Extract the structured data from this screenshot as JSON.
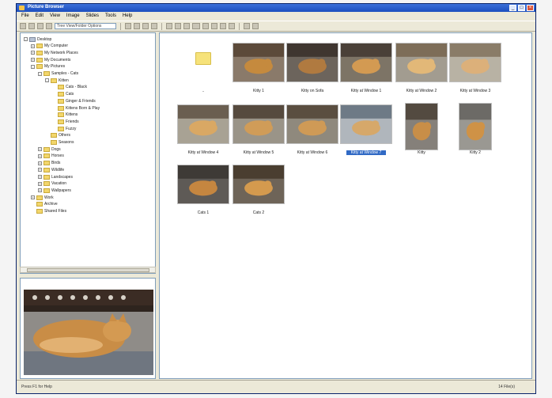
{
  "window": {
    "title": "Picture Browser"
  },
  "menu": [
    "File",
    "Edit",
    "View",
    "Image",
    "Slides",
    "Tools",
    "Help"
  ],
  "toolbar": {
    "address": "Tree View/Folder Options"
  },
  "tree": [
    {
      "label": "Desktop",
      "type": "drive",
      "level": 0,
      "exp": "-"
    },
    {
      "label": "My Computer",
      "type": "folder",
      "level": 1,
      "exp": "+"
    },
    {
      "label": "My Network Places",
      "type": "folder",
      "level": 1,
      "exp": "+"
    },
    {
      "label": "My Documents",
      "type": "folder",
      "level": 1,
      "exp": "+"
    },
    {
      "label": "My Pictures",
      "type": "folder",
      "level": 1,
      "exp": "-"
    },
    {
      "label": "Samples - Cats",
      "type": "folder",
      "level": 2,
      "exp": "-"
    },
    {
      "label": "Kitten",
      "type": "folder",
      "level": 3,
      "exp": "-"
    },
    {
      "label": "Cats - Black",
      "type": "folder",
      "level": 4,
      "exp": ""
    },
    {
      "label": "Cats",
      "type": "folder",
      "level": 4,
      "exp": ""
    },
    {
      "label": "Ginger & Friends",
      "type": "folder",
      "level": 4,
      "exp": ""
    },
    {
      "label": "Kittens Born & Play",
      "type": "folder",
      "level": 4,
      "exp": ""
    },
    {
      "label": "Kittens",
      "type": "folder",
      "level": 4,
      "exp": ""
    },
    {
      "label": "Friends",
      "type": "folder",
      "level": 4,
      "exp": ""
    },
    {
      "label": "Fuzzy",
      "type": "folder",
      "level": 4,
      "exp": ""
    },
    {
      "label": "Others",
      "type": "folder",
      "level": 3,
      "exp": ""
    },
    {
      "label": "Seasons",
      "type": "folder",
      "level": 3,
      "exp": ""
    },
    {
      "label": "Dogs",
      "type": "folder",
      "level": 2,
      "exp": "+"
    },
    {
      "label": "Horses",
      "type": "folder",
      "level": 2,
      "exp": "+"
    },
    {
      "label": "Birds",
      "type": "folder",
      "level": 2,
      "exp": "+"
    },
    {
      "label": "Wildlife",
      "type": "folder",
      "level": 2,
      "exp": "+"
    },
    {
      "label": "Landscapes",
      "type": "folder",
      "level": 2,
      "exp": "+"
    },
    {
      "label": "Vacation",
      "type": "folder",
      "level": 2,
      "exp": "+"
    },
    {
      "label": "Wallpapers",
      "type": "folder",
      "level": 2,
      "exp": "+"
    },
    {
      "label": "Work",
      "type": "folder",
      "level": 1,
      "exp": "+"
    },
    {
      "label": "Archive",
      "type": "folder",
      "level": 1,
      "exp": ""
    },
    {
      "label": "Shared Files",
      "type": "folder",
      "level": 1,
      "exp": ""
    }
  ],
  "thumbs": [
    {
      "label": "..",
      "kind": "folder",
      "selected": false
    },
    {
      "label": "Kitty 1",
      "kind": "photo",
      "selected": false,
      "palette": [
        "#5c4a3a",
        "#c58a3e",
        "#8a7a6a"
      ]
    },
    {
      "label": "Kitty on Sofa",
      "kind": "photo",
      "selected": false,
      "palette": [
        "#3f3630",
        "#b07a40",
        "#6c645c"
      ]
    },
    {
      "label": "Kitty at Window 1",
      "kind": "photo",
      "selected": false,
      "palette": [
        "#4a4038",
        "#d39a52",
        "#7d7466"
      ]
    },
    {
      "label": "Kitty at Window 2",
      "kind": "photo",
      "selected": false,
      "palette": [
        "#7d6d58",
        "#e2b878",
        "#a29c90"
      ]
    },
    {
      "label": "Kitty at Window 3",
      "kind": "photo",
      "selected": false,
      "palette": [
        "#8a7c68",
        "#dcb07a",
        "#b8b2a4"
      ]
    },
    {
      "label": "Kitty at Window 4",
      "kind": "photo",
      "selected": false,
      "palette": [
        "#6a5e50",
        "#d9a864",
        "#a8a294"
      ]
    },
    {
      "label": "Kitty at Window 5",
      "kind": "photo",
      "selected": false,
      "palette": [
        "#564a3e",
        "#d09c58",
        "#9a9488"
      ]
    },
    {
      "label": "Kitty at Window 6",
      "kind": "photo",
      "selected": false,
      "palette": [
        "#5a4e40",
        "#cf9a56",
        "#8f897d"
      ]
    },
    {
      "label": "Kitty at Window 7",
      "kind": "photo",
      "selected": true,
      "palette": [
        "#6e7a86",
        "#d6a86a",
        "#b0b6bc"
      ]
    },
    {
      "label": "Kitty",
      "kind": "photo-tall",
      "selected": false,
      "palette": [
        "#534a40",
        "#c88e48",
        "#85807a"
      ]
    },
    {
      "label": "Kitty 2",
      "kind": "photo-tall",
      "selected": false,
      "palette": [
        "#6c6a66",
        "#cf9246",
        "#9a9892"
      ]
    },
    {
      "label": "Cats 1",
      "kind": "photo",
      "selected": false,
      "palette": [
        "#3e3a36",
        "#c58640",
        "#5e5a56"
      ]
    },
    {
      "label": "Cats 2",
      "kind": "photo",
      "selected": false,
      "palette": [
        "#4a3e30",
        "#d49a4e",
        "#6e6458"
      ]
    }
  ],
  "status": {
    "left": "Press F1 for Help",
    "right": "14 File(s)"
  }
}
